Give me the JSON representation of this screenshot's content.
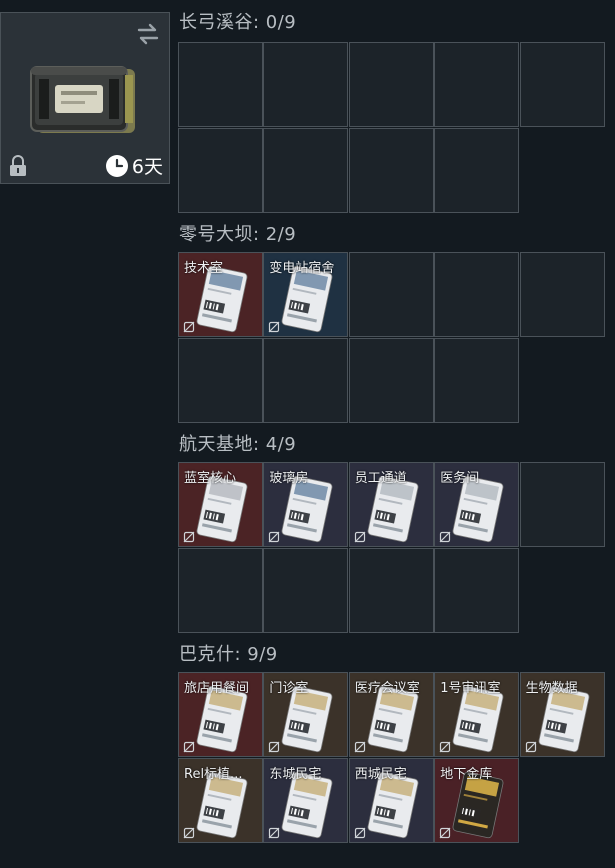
{
  "item": {
    "name_icon": "keycard-case",
    "timer_value": "6天",
    "locked": true
  },
  "sections": [
    {
      "title": "长弓溪谷: 0/9",
      "cards": []
    },
    {
      "title": "零号大坝: 2/9",
      "cards": [
        {
          "label": "技术室",
          "color": "red",
          "variant": "white-blue"
        },
        {
          "label": "变电站宿舍",
          "color": "blue",
          "variant": "white-blue"
        }
      ]
    },
    {
      "title": "航天基地: 4/9",
      "cards": [
        {
          "label": "蓝室核心",
          "color": "red",
          "variant": "white-red"
        },
        {
          "label": "玻璃房",
          "color": "slate",
          "variant": "white-blue"
        },
        {
          "label": "员工通道",
          "color": "slate",
          "variant": "white-gray"
        },
        {
          "label": "医务间",
          "color": "slate",
          "variant": "white-gray"
        }
      ]
    },
    {
      "title": "巴克什: 9/9",
      "cards": [
        {
          "label": "旅店用餐间",
          "color": "red",
          "variant": "white-gold"
        },
        {
          "label": "门诊室",
          "color": "brown",
          "variant": "white-gold"
        },
        {
          "label": "医疗会议室",
          "color": "brown",
          "variant": "white-gold"
        },
        {
          "label": "1号审讯室",
          "color": "brown",
          "variant": "white-gold"
        },
        {
          "label": "生物数据",
          "color": "brown",
          "variant": "white-gold"
        },
        {
          "label": "Rel标植...",
          "color": "brown",
          "variant": "white-gold"
        },
        {
          "label": "东城民宅",
          "color": "slate",
          "variant": "white-gold"
        },
        {
          "label": "西城民宅",
          "color": "slate",
          "variant": "white-gold"
        },
        {
          "label": "地下金库",
          "color": "darkred",
          "variant": "gold"
        }
      ]
    }
  ]
}
